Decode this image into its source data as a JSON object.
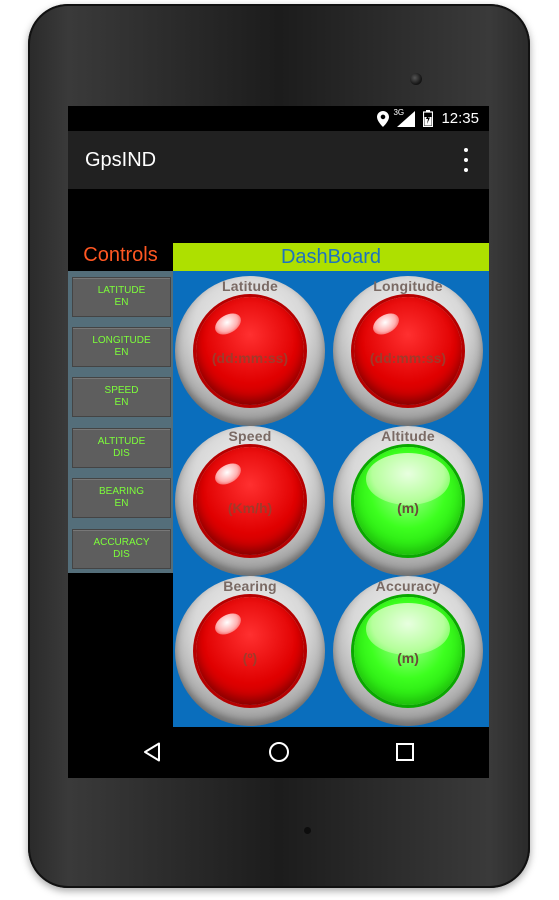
{
  "status_bar": {
    "time": "12:35",
    "network_label": "3G",
    "icons": [
      "location-icon",
      "signal-icon",
      "battery-icon"
    ]
  },
  "app_bar": {
    "title": "GpsIND",
    "overflow_icon": "overflow-menu-icon"
  },
  "controls": {
    "title": "Controls",
    "buttons": [
      {
        "line1": "LATITUDE",
        "line2": "EN"
      },
      {
        "line1": "LONGITUDE",
        "line2": "EN"
      },
      {
        "line1": "SPEED",
        "line2": "EN"
      },
      {
        "line1": "ALTITUDE",
        "line2": "DIS"
      },
      {
        "line1": "BEARING",
        "line2": "EN"
      },
      {
        "line1": "ACCURACY",
        "line2": "DIS"
      }
    ]
  },
  "dashboard": {
    "title": "DashBoard",
    "gauges": [
      {
        "label": "Latitude",
        "unit": "(dd:mm:ss)",
        "state": "red"
      },
      {
        "label": "Longitude",
        "unit": "(dd:mm:ss)",
        "state": "red"
      },
      {
        "label": "Speed",
        "unit": "(Km/h)",
        "state": "red"
      },
      {
        "label": "Altitude",
        "unit": "(m)",
        "state": "green"
      },
      {
        "label": "Bearing",
        "unit": "(º)",
        "state": "red"
      },
      {
        "label": "Accuracy",
        "unit": "(m)",
        "state": "green"
      }
    ]
  },
  "navigation": {
    "icons": [
      "back-icon",
      "home-icon",
      "recent-apps-icon"
    ]
  },
  "colors": {
    "controls_title": "#ff5722",
    "button_text": "#7dff3a",
    "dashboard_header_bg": "#aee000",
    "dashboard_title": "#1e73be",
    "dashboard_bg": "#0a6ebd"
  }
}
